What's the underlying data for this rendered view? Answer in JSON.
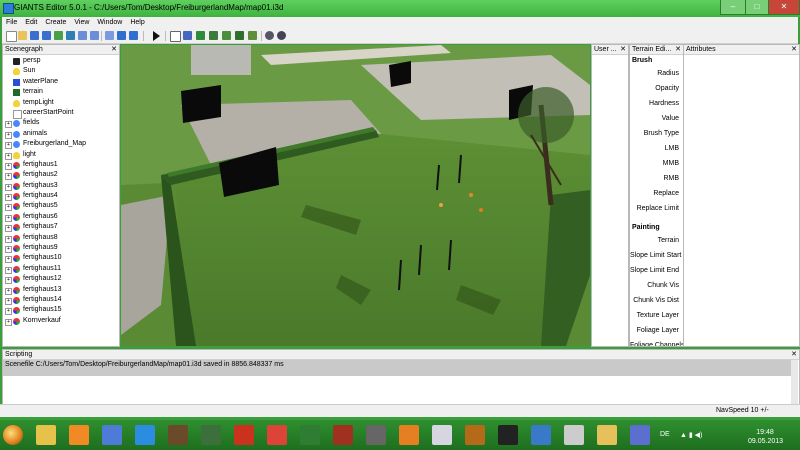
{
  "window": {
    "title": "GIANTS Editor 5.0.1 - C:/Users/Tom/Desktop/FreiburgerlandMap/map01.i3d",
    "minimize_glyph": "–",
    "maximize_glyph": "□",
    "close_glyph": "✕"
  },
  "menu": [
    "File",
    "Edit",
    "Create",
    "View",
    "Window",
    "Help"
  ],
  "toolbar": {
    "icons": [
      "new-file-icon",
      "open-icon",
      "save-icon",
      "save-as-icon",
      "import-icon",
      "export-icon",
      "cut-icon",
      "copy-icon",
      "paste-icon",
      "undo-icon",
      "redo-icon",
      "refresh-icon",
      "play-icon",
      "select-icon",
      "move-icon",
      "rotate-icon",
      "scale-icon",
      "terrain-sculpt-icon",
      "terrain-paint-icon",
      "foliage-icon",
      "camera-icon",
      "orbit-icon"
    ]
  },
  "scenegraph": {
    "title": "Scenegraph",
    "close": "✕",
    "items": [
      {
        "label": "persp",
        "icon": "camera-icon",
        "expandable": false
      },
      {
        "label": "Sun",
        "icon": "light-bulb-icon",
        "expandable": false
      },
      {
        "label": "waterPlane",
        "icon": "plane-icon",
        "expandable": false
      },
      {
        "label": "terrain",
        "icon": "terrain-icon",
        "expandable": false
      },
      {
        "label": "tempLight",
        "icon": "light-bulb-icon",
        "expandable": false
      },
      {
        "label": "careerStartPoint",
        "icon": "point-icon",
        "expandable": false
      },
      {
        "label": "fields",
        "icon": "transform-group-icon",
        "expandable": true
      },
      {
        "label": "animals",
        "icon": "transform-group-icon",
        "expandable": true
      },
      {
        "label": "Freiburgerland_Map",
        "icon": "transform-group-icon",
        "expandable": true
      },
      {
        "label": "light",
        "icon": "light-bulb-icon",
        "expandable": true
      },
      {
        "label": "fertighaus1",
        "icon": "mesh-icon",
        "expandable": true
      },
      {
        "label": "fertighaus2",
        "icon": "mesh-icon",
        "expandable": true
      },
      {
        "label": "fertighaus3",
        "icon": "mesh-icon",
        "expandable": true
      },
      {
        "label": "fertighaus4",
        "icon": "mesh-icon",
        "expandable": true
      },
      {
        "label": "fertighaus5",
        "icon": "mesh-icon",
        "expandable": true
      },
      {
        "label": "fertighaus6",
        "icon": "mesh-icon",
        "expandable": true
      },
      {
        "label": "fertighaus7",
        "icon": "mesh-icon",
        "expandable": true
      },
      {
        "label": "fertighaus8",
        "icon": "mesh-icon",
        "expandable": true
      },
      {
        "label": "fertighaus9",
        "icon": "mesh-icon",
        "expandable": true
      },
      {
        "label": "fertighaus10",
        "icon": "mesh-icon",
        "expandable": true
      },
      {
        "label": "fertighaus11",
        "icon": "mesh-icon",
        "expandable": true
      },
      {
        "label": "fertighaus12",
        "icon": "mesh-icon",
        "expandable": true
      },
      {
        "label": "fertighaus13",
        "icon": "mesh-icon",
        "expandable": true
      },
      {
        "label": "fertighaus14",
        "icon": "mesh-icon",
        "expandable": true
      },
      {
        "label": "fertighaus15",
        "icon": "mesh-icon",
        "expandable": true
      },
      {
        "label": "Kornverkauf",
        "icon": "mesh-icon",
        "expandable": true
      }
    ]
  },
  "user_panel": {
    "title": "User ...",
    "close": "✕"
  },
  "terrain_panel": {
    "title": "Terrain Edi...",
    "close": "✕",
    "brush_heading": "Brush",
    "brush_props": [
      "Radius",
      "Opacity",
      "Hardness",
      "Value",
      "Brush Type",
      "LMB",
      "MMB",
      "RMB",
      "Replace",
      "Replace Limit"
    ],
    "painting_heading": "Painting",
    "painting_props": [
      "Terrain",
      "Slope Limit Start",
      "Slope Limit End",
      "Chunk Vis",
      "Chunk Vis Dist",
      "Texture Layer",
      "Foliage Layer",
      "Foliage Channels"
    ]
  },
  "attributes_panel": {
    "title": "Attributes",
    "close": "✕"
  },
  "scripting": {
    "title": "Scripting",
    "close": "✕",
    "log": "Scenefile C:/Users/Tom/Desktop/FreiburgerlandMap/map01.i3d saved in 8856.848337 ms"
  },
  "status": {
    "navspeed": "NavSpeed 10 +/-"
  },
  "taskbar": {
    "apps": [
      "explorer-icon",
      "media-player-icon",
      "satellite-icon",
      "internet-explorer-icon",
      "minecraft-icon",
      "game-99-icon",
      "farming-2012-icon",
      "chrome-icon",
      "tractor-icon",
      "farm-game-icon",
      "steam-icon",
      "blender-icon",
      "paint-icon",
      "bulldozer-icon",
      "circle-2-icon",
      "messenger-icon",
      "task-icon",
      "folder-icon",
      "editor-icon"
    ],
    "language": "DE",
    "time": "19:48",
    "date": "09.05.2013"
  },
  "colors": {
    "frame": "#3eb23e",
    "panel_bg": "#ffffff",
    "chrome": "#f0f0f0",
    "close_red": "#c7463a"
  }
}
